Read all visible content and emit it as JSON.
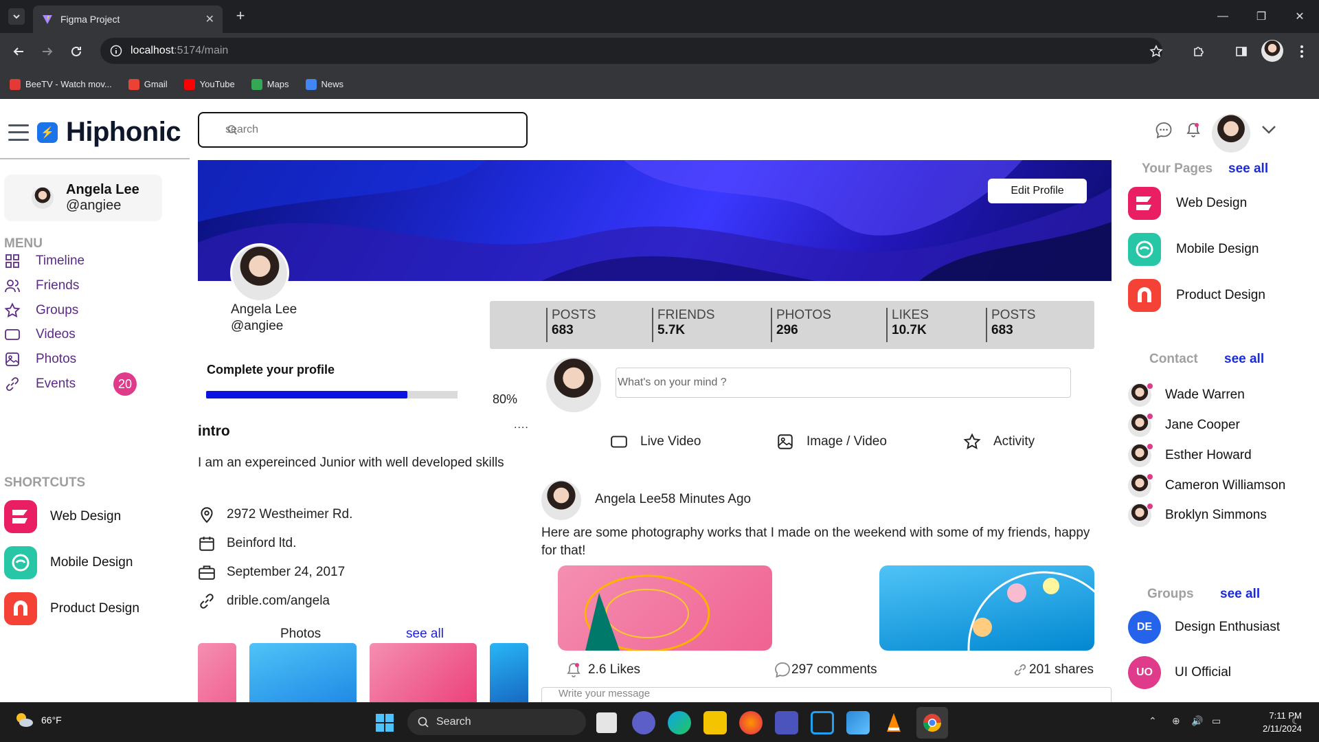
{
  "browser": {
    "tab_title": "Figma Project",
    "url_host": "localhost",
    "url_path": ":5174/main",
    "bookmarks": [
      {
        "label": "BeeTV - Watch mov...",
        "icon": "beetv-icon",
        "color": "#e53935"
      },
      {
        "label": "Gmail",
        "icon": "gmail-icon",
        "color": "#ea4335"
      },
      {
        "label": "YouTube",
        "icon": "youtube-icon",
        "color": "#ff0000"
      },
      {
        "label": "Maps",
        "icon": "maps-icon",
        "color": "#34a853"
      },
      {
        "label": "News",
        "icon": "news-icon",
        "color": "#4285f4"
      }
    ]
  },
  "app": {
    "name": "Hiphonic",
    "search_placeholder": "search"
  },
  "user": {
    "name": "Angela Lee",
    "handle": "@angiee"
  },
  "sidebar": {
    "menu_label": "MENU",
    "menu": [
      {
        "label": "Timeline",
        "icon": "grid-icon"
      },
      {
        "label": "Friends",
        "icon": "users-icon"
      },
      {
        "label": "Groups",
        "icon": "star-icon"
      },
      {
        "label": "Videos",
        "icon": "video-icon"
      },
      {
        "label": "Photos",
        "icon": "image-icon"
      },
      {
        "label": "Events",
        "icon": "link-icon",
        "badge": "20"
      }
    ],
    "shortcuts_label": "SHORTCUTS",
    "shortcuts": [
      {
        "label": "Web Design",
        "color": "#e91e63"
      },
      {
        "label": "Mobile Design",
        "color": "#26c6a6"
      },
      {
        "label": "Product Design",
        "color": "#f44336"
      }
    ]
  },
  "profile": {
    "edit_label": "Edit Profile",
    "stats": [
      {
        "label": "POSTS",
        "value": "683"
      },
      {
        "label": "FRIENDS",
        "value": "5.7K"
      },
      {
        "label": "PHOTOS",
        "value": "296"
      },
      {
        "label": "LIKES",
        "value": "10.7K"
      },
      {
        "label": "POSTS",
        "value": "683"
      }
    ],
    "complete_title": "Complete your profile",
    "complete_percent": 80,
    "complete_label": "80%",
    "intro_title": "intro",
    "intro_more": "....",
    "intro_text": "I am an expereinced Junior with well developed skills",
    "info": [
      {
        "text": "2972 Westheimer Rd.",
        "icon": "location-icon"
      },
      {
        "text": "Beinford ltd.",
        "icon": "calendar-icon"
      },
      {
        "text": "September 24, 2017",
        "icon": "briefcase-icon"
      },
      {
        "text": "drible.com/angela",
        "icon": "link-icon"
      }
    ],
    "photos_title": "Photos",
    "photos_see_all": "see all"
  },
  "composer": {
    "placeholder": "What's on your mind ?",
    "actions": [
      {
        "label": "Live Video",
        "icon": "video-icon"
      },
      {
        "label": "Image / Video",
        "icon": "image-icon"
      },
      {
        "label": "Activity",
        "icon": "star-icon"
      }
    ]
  },
  "post": {
    "author_line": "Angela Lee58 Minutes Ago",
    "text": "Here are some photography works that I made on the weekend with some of my friends, happy for that!",
    "likes": "2.6 Likes",
    "comments": "297 comments",
    "shares": "201 shares",
    "message_placeholder": "Write your message"
  },
  "right": {
    "pages_title": "Your Pages",
    "pages_see_all": "see all",
    "pages": [
      {
        "label": "Web Design",
        "color": "#e91e63"
      },
      {
        "label": "Mobile Design",
        "color": "#26c6a6"
      },
      {
        "label": "Product Design",
        "color": "#f44336"
      }
    ],
    "contact_title": "Contact",
    "contact_see_all": "see all",
    "contacts": [
      "Wade Warren",
      "Jane Cooper",
      "Esther Howard",
      "Cameron Williamson",
      "Broklyn Simmons"
    ],
    "groups_title": "Groups",
    "groups_see_all": "see all",
    "groups": [
      {
        "initials": "DE",
        "label": "Design Enthusiast",
        "color": "#2563eb"
      },
      {
        "initials": "UO",
        "label": "UI Official",
        "color": "#e03a8a"
      }
    ]
  },
  "taskbar": {
    "temperature": "66°F",
    "search_label": "Search",
    "time": "7:11 PM",
    "date": "2/11/2024"
  }
}
